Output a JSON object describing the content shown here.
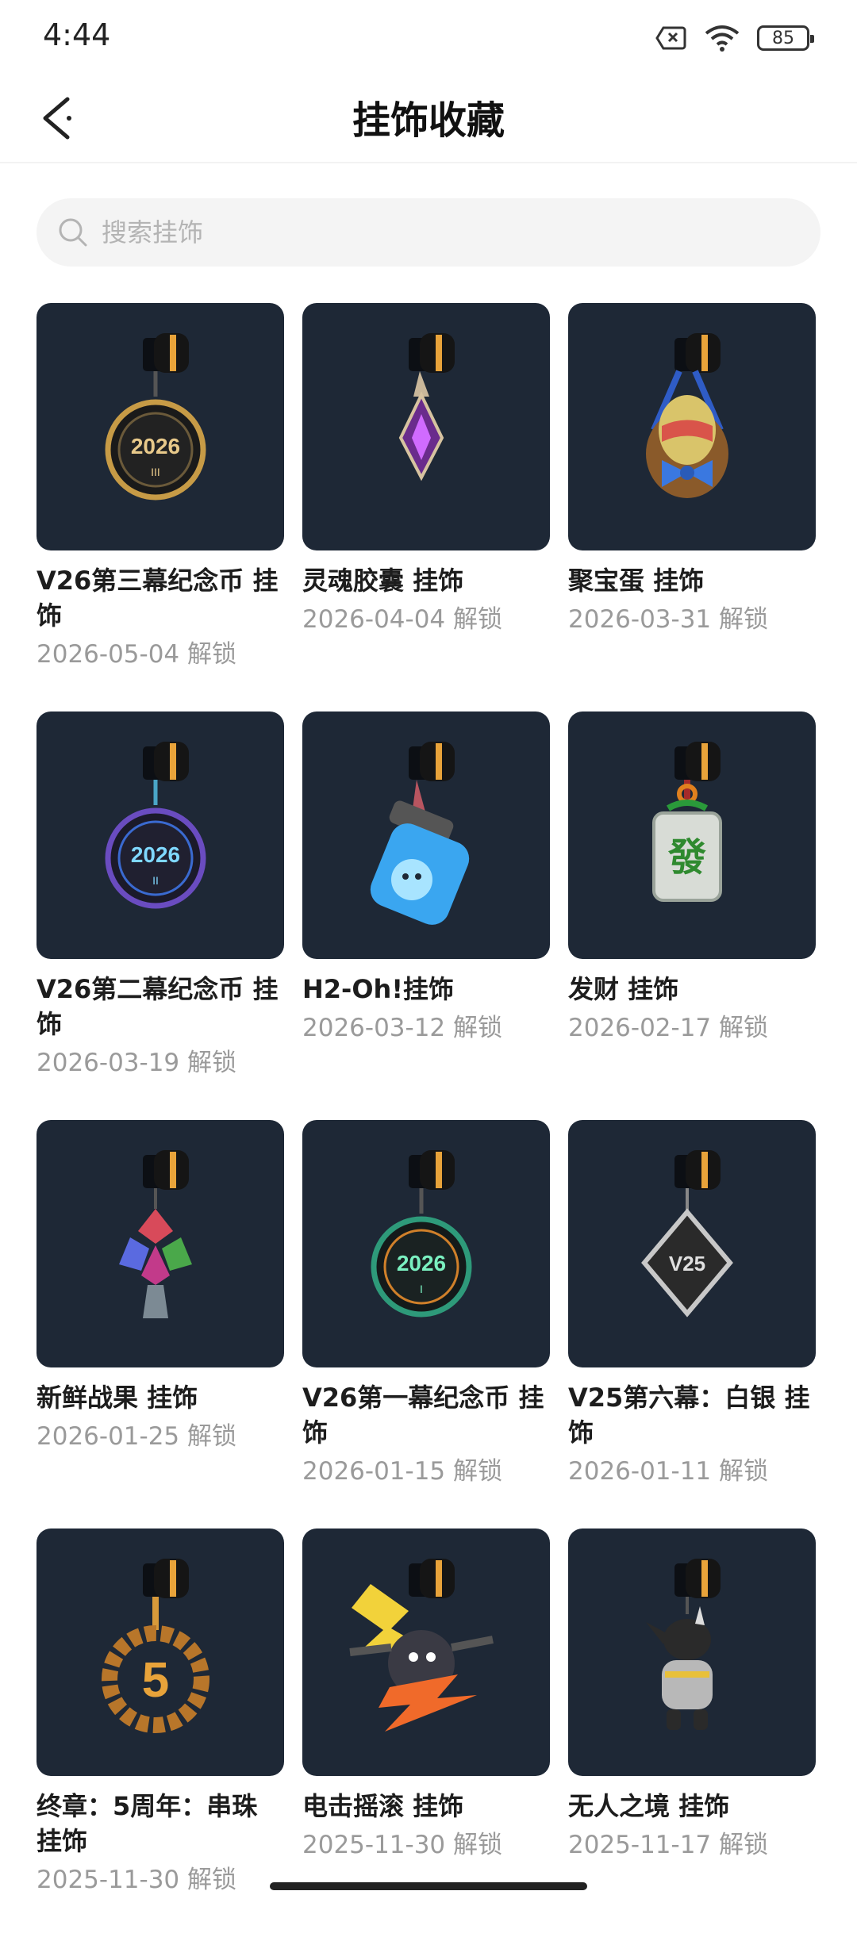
{
  "status": {
    "time": "4:44",
    "battery": "85"
  },
  "nav": {
    "title": "挂饰收藏"
  },
  "search": {
    "placeholder": "搜索挂饰"
  },
  "items": [
    {
      "title": "V26第三幕纪念币 挂饰",
      "date": "2026-05-04 解锁"
    },
    {
      "title": "灵魂胶囊 挂饰",
      "date": "2026-04-04 解锁"
    },
    {
      "title": "聚宝蛋 挂饰",
      "date": "2026-03-31 解锁"
    },
    {
      "title": "V26第二幕纪念币 挂饰",
      "date": "2026-03-19 解锁"
    },
    {
      "title": "H2-Oh!挂饰",
      "date": "2026-03-12 解锁"
    },
    {
      "title": "发财 挂饰",
      "date": "2026-02-17 解锁"
    },
    {
      "title": "新鲜战果 挂饰",
      "date": "2026-01-25 解锁"
    },
    {
      "title": "V26第一幕纪念币 挂饰",
      "date": "2026-01-15 解锁"
    },
    {
      "title": "V25第六幕：白银 挂饰",
      "date": "2026-01-11 解锁"
    },
    {
      "title": "终章：5周年：串珠 挂饰",
      "date": "2025-11-30 解锁"
    },
    {
      "title": "电击摇滚 挂饰",
      "date": "2025-11-30 解锁"
    },
    {
      "title": "无人之境 挂饰",
      "date": "2025-11-17 解锁"
    }
  ],
  "art": {
    "coin1": {
      "text": "2026",
      "sub": "III"
    },
    "coin2": {
      "text": "2026",
      "sub": "II"
    },
    "coin3": {
      "text": "2026",
      "sub": "I"
    },
    "mahjong": {
      "text": "發"
    },
    "silver": {
      "text": "V25"
    },
    "beads": {
      "text": "5"
    }
  },
  "colors": {
    "card_bg": "#1e2836",
    "title": "#1d1d1d",
    "date": "#9a9a9a"
  }
}
